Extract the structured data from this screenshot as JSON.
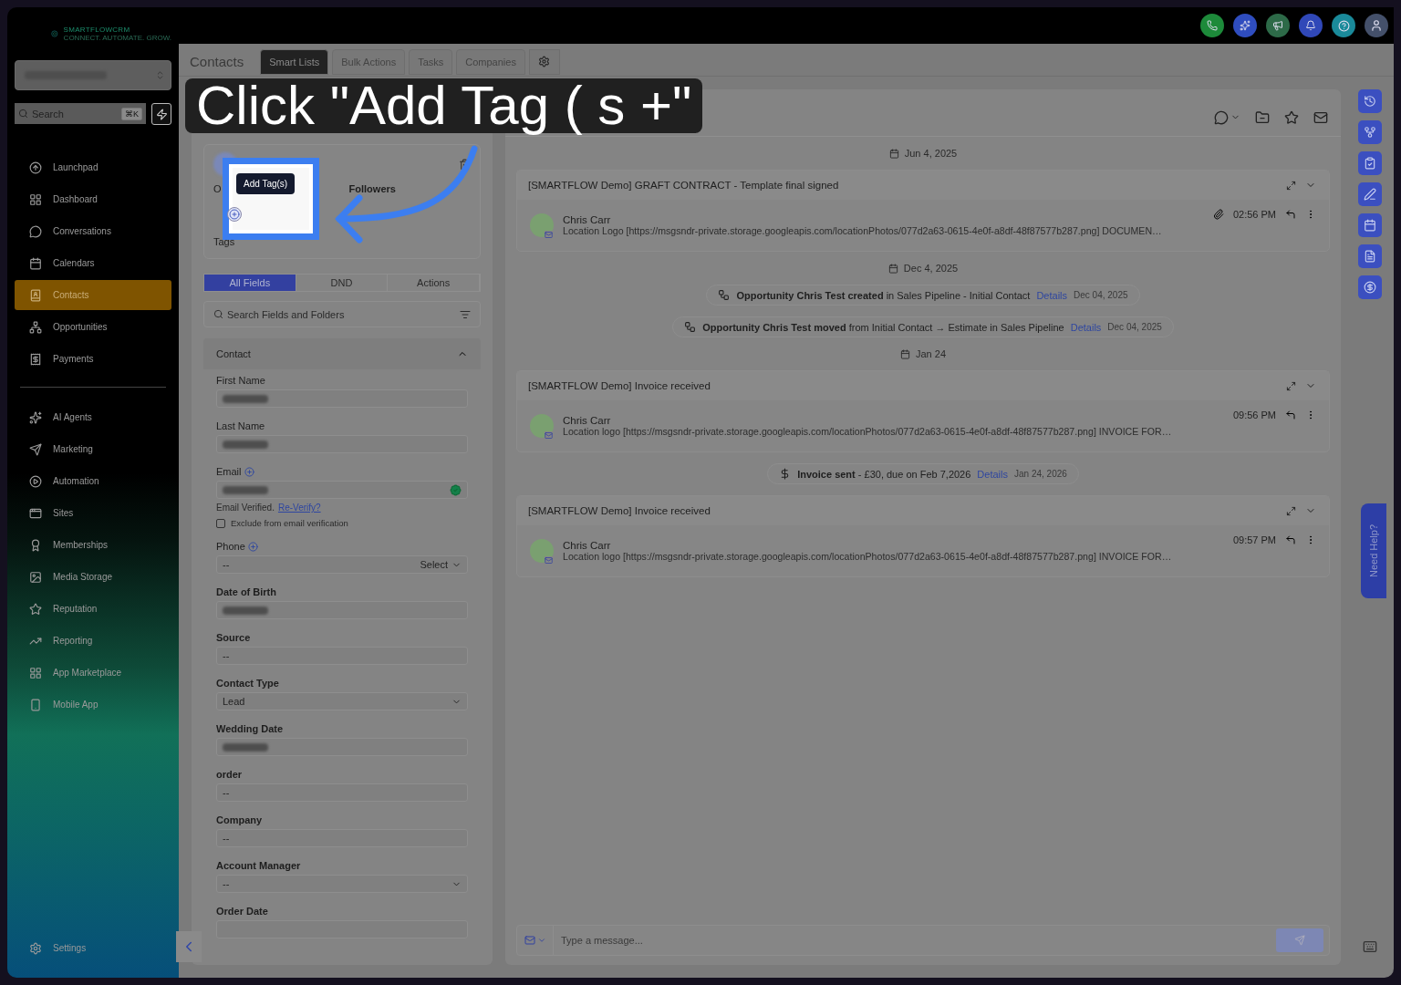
{
  "annotation": {
    "text": "Click \"Add Tag ( s +\"",
    "tooltip": "Add Tag(s)"
  },
  "sidebar": {
    "logo": {
      "name": "SMARTFLOWCRM",
      "tagline": "CONNECT. AUTOMATE. GROW."
    },
    "search": {
      "placeholder": "Search",
      "shortcut": "⌘K"
    },
    "primary": [
      {
        "label": "Launchpad",
        "selected": false
      },
      {
        "label": "Dashboard",
        "selected": false
      },
      {
        "label": "Conversations",
        "selected": false
      },
      {
        "label": "Calendars",
        "selected": false
      },
      {
        "label": "Contacts",
        "selected": true
      },
      {
        "label": "Opportunities",
        "selected": false
      },
      {
        "label": "Payments",
        "selected": false
      }
    ],
    "secondary": [
      {
        "label": "AI Agents",
        "selected": false
      },
      {
        "label": "Marketing",
        "selected": false
      },
      {
        "label": "Automation",
        "selected": false
      },
      {
        "label": "Sites",
        "selected": false
      },
      {
        "label": "Memberships",
        "selected": false
      },
      {
        "label": "Media Storage",
        "selected": false
      },
      {
        "label": "Reputation",
        "selected": false
      },
      {
        "label": "Reporting",
        "selected": false
      },
      {
        "label": "App Marketplace",
        "selected": false
      },
      {
        "label": "Mobile App",
        "selected": false
      }
    ],
    "settings": "Settings"
  },
  "page": {
    "title": "Contacts",
    "tabs": [
      {
        "label": "Smart Lists",
        "selected": true
      },
      {
        "label": "Bulk Actions",
        "selected": false
      },
      {
        "label": "Tasks",
        "selected": false
      },
      {
        "label": "Companies",
        "selected": false
      }
    ]
  },
  "contact": {
    "owner_label": "O",
    "followers_label": "Followers",
    "tags_label": "Tags",
    "tabs": [
      {
        "label": "All Fields",
        "selected": true
      },
      {
        "label": "DND",
        "selected": false
      },
      {
        "label": "Actions",
        "selected": false
      }
    ],
    "field_search": {
      "placeholder": "Search Fields and Folders"
    },
    "section": {
      "title": "Contact",
      "expanded": true
    },
    "fields": [
      {
        "kind": "text",
        "label": "First Name",
        "strong": false,
        "add": false,
        "blurred": true
      },
      {
        "kind": "text",
        "label": "Last Name",
        "strong": false,
        "add": false,
        "blurred": true
      },
      {
        "kind": "email",
        "label": "Email",
        "strong": false,
        "add": true,
        "blurred": true,
        "verified_text": "Email Verified.",
        "reverify": "Re-Verify?",
        "exclude": {
          "label": "Exclude from email verification",
          "checked": false
        }
      },
      {
        "kind": "phone",
        "label": "Phone",
        "strong": false,
        "add": true,
        "blurred": false,
        "value": "--",
        "select": "Select"
      },
      {
        "kind": "text",
        "label": "Date of Birth",
        "strong": true,
        "add": false,
        "blurred": true
      },
      {
        "kind": "text",
        "label": "Source",
        "strong": true,
        "add": false,
        "blurred": false,
        "value": "--"
      },
      {
        "kind": "select",
        "label": "Contact Type",
        "strong": true,
        "add": false,
        "blurred": false,
        "value": "Lead"
      },
      {
        "kind": "text",
        "label": "Wedding Date",
        "strong": true,
        "add": false,
        "blurred": true
      },
      {
        "kind": "text",
        "label": "order",
        "strong": true,
        "add": false,
        "blurred": false,
        "value": "--"
      },
      {
        "kind": "text",
        "label": "Company",
        "strong": true,
        "add": false,
        "blurred": false,
        "value": "--"
      },
      {
        "kind": "select",
        "label": "Account Manager",
        "strong": true,
        "add": false,
        "blurred": false,
        "value": "--"
      },
      {
        "kind": "text",
        "label": "Order Date",
        "strong": true,
        "add": false,
        "blurred": false
      }
    ]
  },
  "timeline": [
    {
      "kind": "date",
      "text": "Jun 4, 2025"
    },
    {
      "kind": "email",
      "subject": "[SMARTFLOW Demo] GRAFT CONTRACT - Template final signed",
      "sender": "Chris Carr",
      "preview": "Location Logo [https://msgsndr-private.storage.googleapis.com/locationPhotos/077d2a63-0615-4e0f-a8df-48f87577b287.png] DOCUMEN…",
      "time": "02:56 PM",
      "attachment": true
    },
    {
      "kind": "date",
      "text": "Dec 4, 2025"
    },
    {
      "kind": "opportunity",
      "text": "**Opportunity Chris Test created** in Sales Pipeline - Initial Contact",
      "link": "Details",
      "date": "Dec 04, 2025"
    },
    {
      "kind": "opportunity",
      "text": "**Opportunity Chris Test moved** from Initial Contact → Estimate in Sales Pipeline",
      "link": "Details",
      "date": "Dec 04, 2025"
    },
    {
      "kind": "date",
      "text": "Jan 24"
    },
    {
      "kind": "email",
      "subject": "[SMARTFLOW Demo] Invoice received",
      "sender": "Chris Carr",
      "preview": "Location logo [https://msgsndr-private.storage.googleapis.com/locationPhotos/077d2a63-0615-4e0f-a8df-48f87577b287.png] INVOICE FOR…",
      "time": "09:56 PM",
      "attachment": false
    },
    {
      "kind": "invoice",
      "text": "**Invoice sent** - £30, due on Feb 7,2026",
      "link": "Details",
      "date": "Jan 24, 2026"
    },
    {
      "kind": "email",
      "subject": "[SMARTFLOW Demo] Invoice received",
      "sender": "Chris Carr",
      "preview": "Location logo [https://msgsndr-private.storage.googleapis.com/locationPhotos/077d2a63-0615-4e0f-a8df-48f87577b287.png] INVOICE FOR…",
      "time": "09:57 PM",
      "attachment": false
    }
  ],
  "composer": {
    "placeholder": "Type a message..."
  },
  "help_tab": "Need Help?"
}
